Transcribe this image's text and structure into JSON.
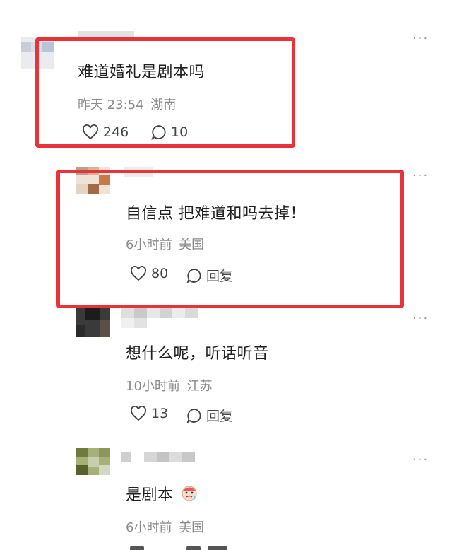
{
  "colors": {
    "highlight": "#e8333b",
    "meta": "#8a8a8a"
  },
  "comments": [
    {
      "text": "难道婚礼是剧本吗",
      "time": "昨天 23:54",
      "location": "湖南",
      "likes": "246",
      "replies": "10"
    },
    {
      "text": "自信点 把难道和吗去掉！",
      "time": "6小时前",
      "location": "美国",
      "likes": "80",
      "reply_label": "回复"
    },
    {
      "text": "想什么呢，听话听音",
      "time": "10小时前",
      "location": "江苏",
      "likes": "13",
      "reply_label": "回复"
    },
    {
      "text": "是剧本",
      "time": "6小时前",
      "location": "美国"
    }
  ],
  "more_label": "···"
}
